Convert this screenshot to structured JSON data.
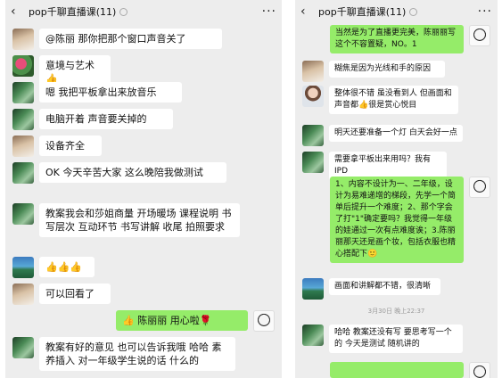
{
  "left": {
    "title": "pop千聊直播课(11)",
    "messages": [
      {
        "dir": "in",
        "avatar": "av-photo",
        "text": "@陈丽  那你把那个窗口声音关了"
      },
      {
        "dir": "in",
        "avatar": "av-flower",
        "text": "意境与艺术👍"
      },
      {
        "dir": "in",
        "avatar": "av-tree",
        "text": "嗯  我把平板拿出来放音乐"
      },
      {
        "dir": "in",
        "avatar": "av-tree",
        "text": "电脑开着 声音要关掉的"
      },
      {
        "dir": "in",
        "avatar": "av-photo",
        "text": "设备齐全"
      },
      {
        "dir": "in",
        "avatar": "av-tree",
        "text": "OK  今天辛苦大家 这么晚陪我做测试"
      },
      {
        "dir": "in",
        "avatar": "av-tree",
        "text": "教案我会和莎姐商量 开场暖场  课程说明  书写层次  互动环节  书写讲解  收尾  拍照要求"
      },
      {
        "dir": "in",
        "avatar": "av-lake",
        "text": "👍👍👍"
      },
      {
        "dir": "in",
        "avatar": "av-photo",
        "text": "可以回看了"
      },
      {
        "dir": "out",
        "avatar": "av-cartoon",
        "text": "👍  陈丽丽  用心啦🌹"
      },
      {
        "dir": "in",
        "avatar": "av-tree",
        "text": "教案有好的意见 也可以告诉我哦 哈哈  素养插入  对一年级学生说的话  什么的"
      }
    ]
  },
  "right": {
    "title": "pop千聊直播课(11)",
    "messages": [
      {
        "dir": "out",
        "avatar": "av-cartoon",
        "text": "当然是为了直播更完美，陈丽丽写这个不容置疑，NO。1"
      },
      {
        "dir": "in",
        "avatar": "av-photo",
        "text": "糊焦是因为光线和手的原因"
      },
      {
        "dir": "in",
        "avatar": "av-portrait",
        "text": "整体很不错 虽没看到人 但画面和声音都👍很是赏心悦目"
      },
      {
        "dir": "in",
        "avatar": "av-tree",
        "text": "明天还要准备一个灯  白天会好一点"
      },
      {
        "dir": "in",
        "avatar": "av-tree",
        "text": "需要拿平板出来用吗？我有IPD"
      },
      {
        "dir": "out",
        "avatar": "av-cartoon",
        "text": "1、内容不设计为一、二年级，设计为易难递增的梯段，先学一个简单后提升一个难度；2、那个字会了打\"1\"确定要吗？我觉得一年级的娃通过一次有点难度诶；3.陈丽丽那天还是画个妆，包括衣服也精心搭配下🙂"
      },
      {
        "dir": "in",
        "avatar": "av-lake",
        "text": "画面和讲解都不错，很清晰"
      },
      {
        "dir": "ts",
        "text": "3月30日 晚上22:37"
      },
      {
        "dir": "in",
        "avatar": "av-tree",
        "text": "哈哈  教案还没有写  要思考写一个的  今天是测试 随机讲的"
      }
    ]
  }
}
